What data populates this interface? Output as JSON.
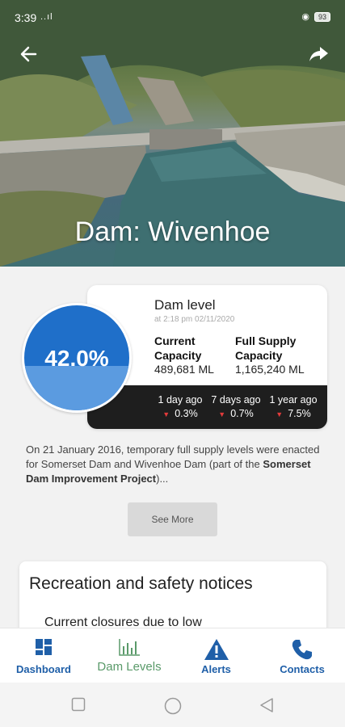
{
  "status": {
    "time": "3:39",
    "signal": "..ıl",
    "battery": "93"
  },
  "hero": {
    "title": "Dam: Wivenhoe"
  },
  "level": {
    "percent_label": "42.0%",
    "percent_value": 42.0,
    "title": "Dam level",
    "timestamp": "at 2:18 pm 02/11/2020",
    "current_label": "Current Capacity",
    "current_value": "489,681 ML",
    "full_label": "Full Supply Capacity",
    "full_value": "1,165,240 ML",
    "changes": [
      {
        "period": "1 day ago",
        "value": "0.3%"
      },
      {
        "period": "7 days ago",
        "value": "0.7%"
      },
      {
        "period": "1 year ago",
        "value": "7.5%"
      }
    ]
  },
  "description": {
    "text_before": "On 21 January 2016, temporary full supply levels were enacted for Somerset Dam and Wivenhoe Dam (part of the ",
    "bold": "Somerset Dam Improvement Project",
    "text_after": ")..."
  },
  "see_more": "See More",
  "notices": {
    "title": "Recreation and safety notices",
    "first_item": "Current closures due to low"
  },
  "nav": {
    "items": [
      {
        "label": "Dashboard",
        "icon": "dashboard-icon"
      },
      {
        "label": "Dam Levels",
        "icon": "bar-chart-icon"
      },
      {
        "label": "Alerts",
        "icon": "warning-icon"
      },
      {
        "label": "Contacts",
        "icon": "phone-icon"
      }
    ]
  },
  "colors": {
    "primary": "#1f5fa8",
    "active": "#5a9a6a",
    "gauge_dark": "#1f6fc9",
    "gauge_light": "#5b9be0",
    "down_arrow": "#e23b3b"
  }
}
